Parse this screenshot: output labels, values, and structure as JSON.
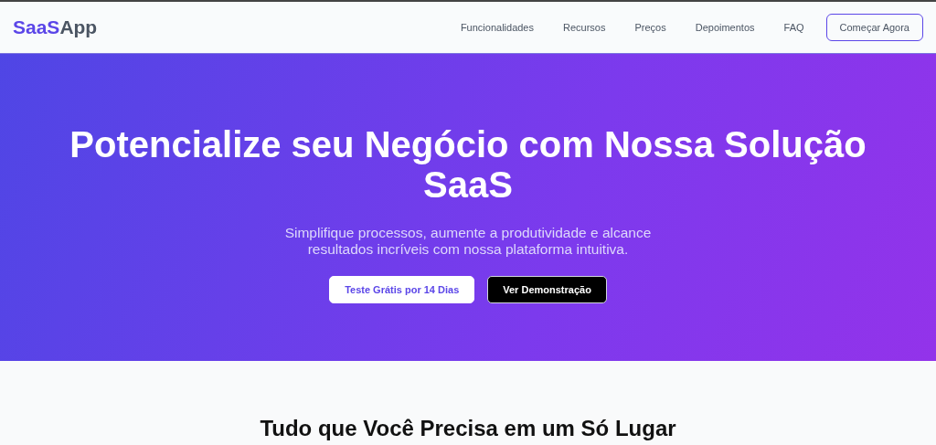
{
  "header": {
    "logo": {
      "accent": "SaaS",
      "rest": "App"
    },
    "nav": [
      {
        "label": "Funcionalidades"
      },
      {
        "label": "Recursos"
      },
      {
        "label": "Preços"
      },
      {
        "label": "Depoimentos"
      },
      {
        "label": "FAQ"
      }
    ],
    "cta": "Começar Agora"
  },
  "hero": {
    "title": "Potencialize seu Negócio com Nossa Solução SaaS",
    "subtitle": "Simplifique processos, aumente a produtividade e alcance resultados incríveis com nossa plataforma intuitiva.",
    "buttons": [
      {
        "label": "Teste Grátis por 14 Dias",
        "kind": "primary"
      },
      {
        "label": "Ver Demonstração",
        "kind": "secondary"
      }
    ]
  },
  "features": {
    "heading": "Tudo que Você Precisa em um Só Lugar"
  }
}
